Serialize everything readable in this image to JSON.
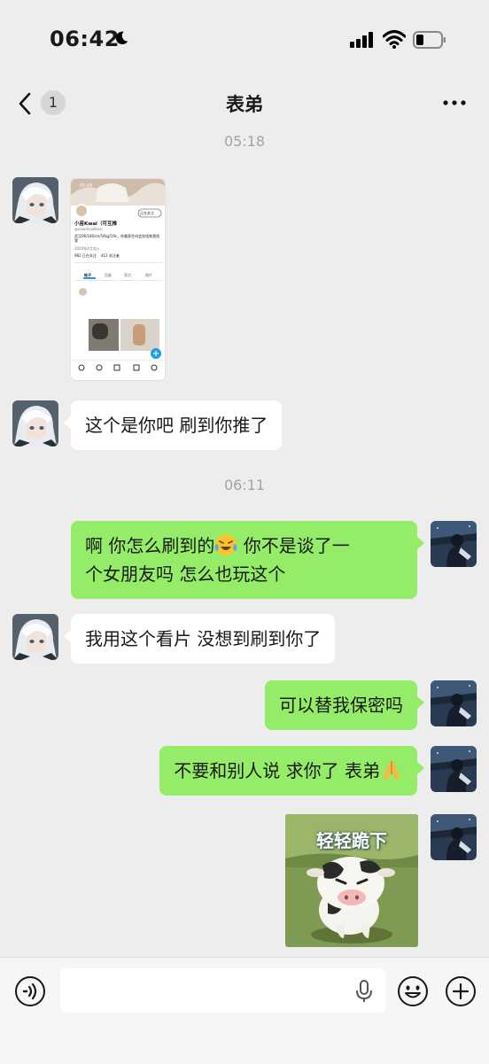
{
  "status_bar": {
    "time": "06:42"
  },
  "nav": {
    "unread_count": "1",
    "title": "表弟"
  },
  "messages": [
    {
      "type": "timestamp",
      "text": "05:18"
    },
    {
      "type": "image",
      "from": "cousin",
      "content": {
        "time": "05:09",
        "follow_label": "正在关注",
        "name": "小苗Kwai（可互推",
        "handle": "@xiaomiaoKwai",
        "bio": "武汉06/180cm/54kg/19c，你最养住吗会别找和我找我",
        "joined": "2020年4月加入",
        "following": "982 正在关注",
        "followers": "412 关注者",
        "tabs": [
          "帖子",
          "回复",
          "亮点",
          "图片"
        ]
      }
    },
    {
      "type": "text",
      "from": "cousin",
      "text": "这个是你吧 刷到你推了"
    },
    {
      "type": "timestamp",
      "text": "06:11"
    },
    {
      "type": "text",
      "from": "me",
      "line1_before": "啊 你怎么刷到的",
      "line1_after": " 你不是谈了一",
      "line2": "个女朋友吗 怎么也玩这个"
    },
    {
      "type": "text",
      "from": "cousin",
      "text": "我用这个看片 没想到刷到你了"
    },
    {
      "type": "text",
      "from": "me",
      "text": "可以替我保密吗"
    },
    {
      "type": "text",
      "from": "me",
      "text": "不要和别人说 求你了 表弟"
    },
    {
      "type": "sticker",
      "from": "me",
      "caption": "轻轻跪下"
    }
  ],
  "input": {
    "placeholder": "",
    "value": ""
  },
  "icons": {
    "back": "chevron-left-icon",
    "more": "more-dots-icon",
    "voice": "voice-icon",
    "mic": "mic-icon",
    "emoji": "emoji-icon",
    "plus": "plus-icon",
    "laugh_cry": "face-with-tears-of-joy-icon",
    "pray": "folded-hands-icon"
  },
  "colors": {
    "background": "#ededed",
    "my_bubble": "#95ec69",
    "their_bubble": "#ffffff"
  }
}
